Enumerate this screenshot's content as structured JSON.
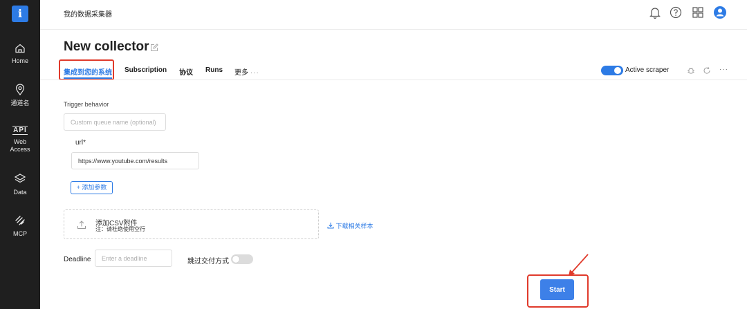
{
  "app": {
    "logo": "i",
    "title": "我的数据采集器"
  },
  "sidebar": {
    "items": [
      {
        "label": "Home",
        "icon": "home-icon"
      },
      {
        "label": "通道名",
        "icon": "location-pin-icon"
      },
      {
        "label": "Web\nAccess",
        "icon": "api-icon",
        "icon_text": "API"
      },
      {
        "label": "Data",
        "icon": "layers-icon"
      },
      {
        "label": "MCP",
        "icon": "mcp-icon"
      }
    ]
  },
  "header": {
    "icons": [
      "bell-icon",
      "help-icon",
      "apps-grid-icon",
      "user-avatar-icon"
    ]
  },
  "page": {
    "title": "New collector"
  },
  "tabs": [
    {
      "label": "集成到您的系统",
      "active": true
    },
    {
      "label": "Subscription"
    },
    {
      "label": "协议"
    },
    {
      "label": "Runs"
    },
    {
      "label": "更多"
    }
  ],
  "toolbar": {
    "active_scraper_label": "Active scraper",
    "active_scraper_on": true,
    "icons": [
      "debug-icon",
      "refresh-icon",
      "more-icon"
    ]
  },
  "form": {
    "trigger_behavior_label": "Trigger behavior",
    "queue_placeholder": "Custom queue name (optional)",
    "url_label": "url*",
    "url_value": "https://www.youtube.com/results",
    "add_param_label": "+ 添加参数",
    "upload_title": "添加CSV附件",
    "upload_note": "注：请杜绝使用空行",
    "download_sample_label": "下载相关样本",
    "deadline_label": "Deadline",
    "deadline_placeholder": "Enter a deadline",
    "skip_delivery_label": "跳过交付方式",
    "skip_delivery_on": false,
    "start_label": "Start"
  },
  "colors": {
    "accent": "#2d7be5",
    "sidebar_bg": "#1f1f1f",
    "highlight": "#e03a2b"
  }
}
